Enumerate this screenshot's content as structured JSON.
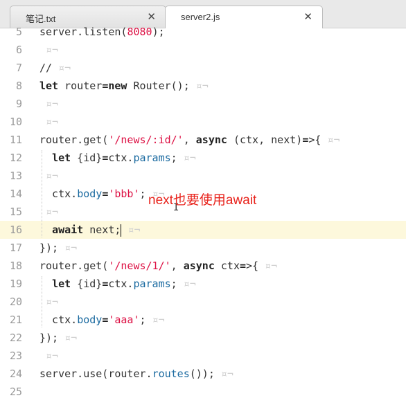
{
  "tabs": [
    {
      "label": "笔记.txt",
      "close": "✕",
      "active": false
    },
    {
      "label": "server2.js",
      "close": "✕",
      "active": true
    }
  ],
  "editor": {
    "lines": [
      {
        "n": "5",
        "t": "server.listen(8080);"
      },
      {
        "n": "6",
        "t": ""
      },
      {
        "n": "7",
        "t": "//"
      },
      {
        "n": "8",
        "t": "let router=new Router();"
      },
      {
        "n": "9",
        "t": ""
      },
      {
        "n": "10",
        "t": ""
      },
      {
        "n": "11",
        "t": "router.get('/news/:id/', async (ctx, next)=>{"
      },
      {
        "n": "12",
        "t": "  let {id}=ctx.params;"
      },
      {
        "n": "13",
        "t": ""
      },
      {
        "n": "14",
        "t": "  ctx.body='bbb';"
      },
      {
        "n": "15",
        "t": ""
      },
      {
        "n": "16",
        "t": "  await next;"
      },
      {
        "n": "17",
        "t": "});"
      },
      {
        "n": "18",
        "t": "router.get('/news/1/', async ctx=>{"
      },
      {
        "n": "19",
        "t": "  let {id}=ctx.params;"
      },
      {
        "n": "20",
        "t": ""
      },
      {
        "n": "21",
        "t": "  ctx.body='aaa';"
      },
      {
        "n": "22",
        "t": "});"
      },
      {
        "n": "23",
        "t": ""
      },
      {
        "n": "24",
        "t": "server.use(router.routes());"
      },
      {
        "n": "25",
        "t": ""
      }
    ],
    "whitespace_marker": "¤¬",
    "current_line": "16"
  },
  "annotation": "next也要使用await",
  "colors": {
    "annotation": "#e8231c",
    "current_line_bg": "#fdf8dc",
    "string": "#dd1144",
    "property": "#1a6aa0"
  }
}
